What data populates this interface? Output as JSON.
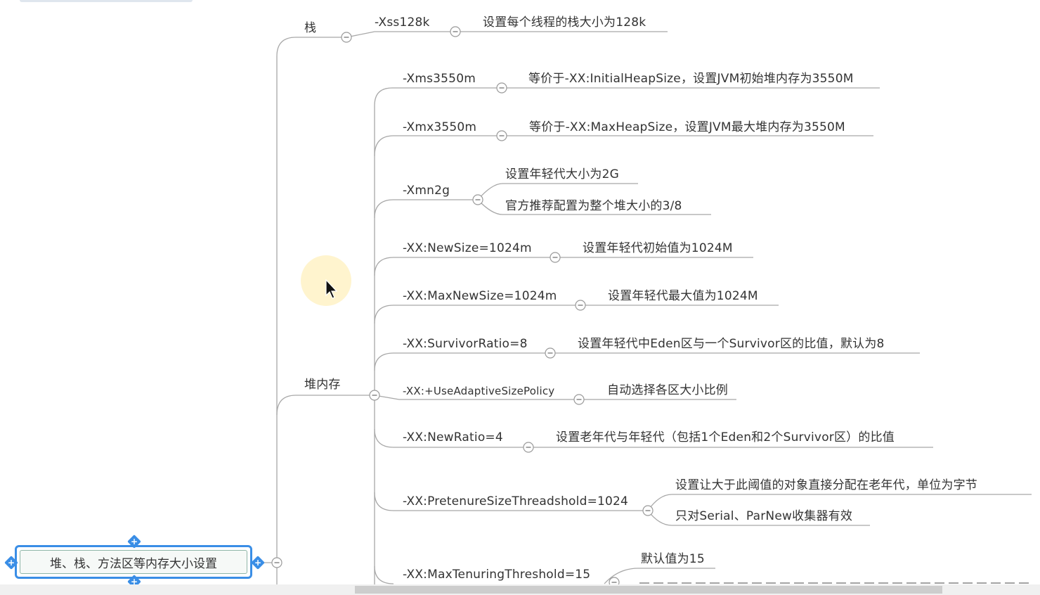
{
  "root": {
    "label": "堆、栈、方法区等内存大小设置"
  },
  "branches": {
    "stack": {
      "label": "栈",
      "param": "-Xss128k",
      "desc": "设置每个线程的栈大小为128k"
    },
    "heap": {
      "label": "堆内存",
      "items": [
        {
          "param": "-Xms3550m",
          "desc": [
            "等价于-XX:InitialHeapSize，设置JVM初始堆内存为3550M"
          ]
        },
        {
          "param": "-Xmx3550m",
          "desc": [
            "等价于-XX:MaxHeapSize，设置JVM最大堆内存为3550M"
          ]
        },
        {
          "param": "-Xmn2g",
          "desc": [
            "设置年轻代大小为2G",
            "官方推荐配置为整个堆大小的3/8"
          ]
        },
        {
          "param": "-XX:NewSize=1024m",
          "desc": [
            "设置年轻代初始值为1024M"
          ]
        },
        {
          "param": "-XX:MaxNewSize=1024m",
          "desc": [
            "设置年轻代最大值为1024M"
          ]
        },
        {
          "param": "-XX:SurvivorRatio=8",
          "desc": [
            "设置年轻代中Eden区与一个Survivor区的比值，默认为8"
          ]
        },
        {
          "param": "-XX:+UseAdaptiveSizePolicy",
          "desc": [
            "自动选择各区大小比例"
          ]
        },
        {
          "param": "-XX:NewRatio=4",
          "desc": [
            "设置老年代与年轻代（包括1个Eden和2个Survivor区）的比值"
          ]
        },
        {
          "param": "-XX:PretenureSizeThreadshold=1024",
          "desc": [
            "设置让大于此阈值的对象直接分配在老年代，单位为字节",
            "只对Serial、ParNew收集器有效"
          ]
        },
        {
          "param": "-XX:MaxTenuringThreshold=15",
          "desc": [
            "默认值为15"
          ]
        }
      ]
    }
  },
  "colors": {
    "line": "#a8a8a8",
    "selection": "#3a8ee6",
    "text": "#333333"
  },
  "icons": {
    "collapse": "minus-circle-icon",
    "cursor": "arrow-cursor-icon",
    "handle": "plus-handle-icon"
  }
}
